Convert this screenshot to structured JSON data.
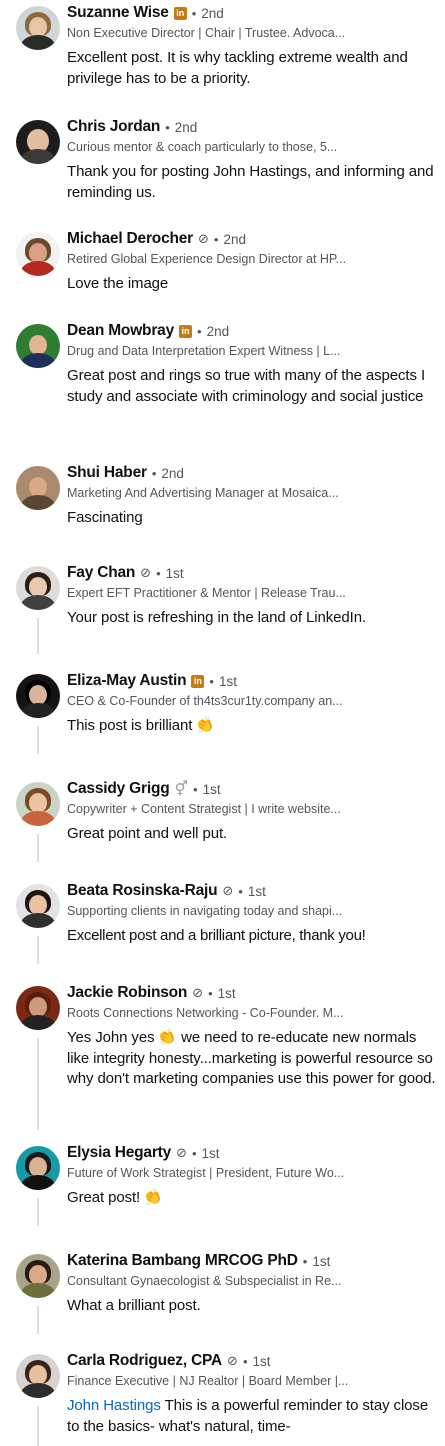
{
  "comments": [
    {
      "name": "Suzanne Wise",
      "badge": "in",
      "verified": false,
      "pronoun": false,
      "sep": "•",
      "degree": "2nd",
      "headline": "Non Executive Director | Chair | Trustee. Advoca...",
      "body": "Excellent post. It is why tackling extreme wealth and privilege has to be a priority."
    },
    {
      "name": "Chris Jordan",
      "badge": "",
      "verified": false,
      "pronoun": false,
      "sep": "•",
      "degree": "2nd",
      "headline": "Curious mentor & coach particularly to those, 5...",
      "body": "Thank you for posting John Hastings, and informing and reminding us."
    },
    {
      "name": "Michael Derocher",
      "badge": "",
      "verified": true,
      "pronoun": false,
      "sep": "•",
      "degree": "2nd",
      "headline": "Retired Global Experience Design Director at HP...",
      "body": "Love the image"
    },
    {
      "name": "Dean Mowbray",
      "badge": "in",
      "verified": false,
      "pronoun": false,
      "sep": "•",
      "degree": "2nd",
      "headline": "Drug and Data Interpretation Expert Witness | L...",
      "body": "Great post and rings so true with many of the aspects I study and associate with criminology and social justice"
    },
    {
      "name": "Shui Haber",
      "badge": "",
      "verified": false,
      "pronoun": false,
      "sep": "•",
      "degree": "2nd",
      "headline": "Marketing And Advertising Manager at Mosaica...",
      "body": "Fascinating"
    },
    {
      "name": "Fay Chan",
      "badge": "",
      "verified": true,
      "pronoun": false,
      "sep": "•",
      "degree": "1st",
      "headline": "Expert EFT Practitioner & Mentor | Release Trau...",
      "body": "Your post is refreshing in the land of LinkedIn."
    },
    {
      "name": "Eliza-May Austin",
      "badge": "in",
      "verified": false,
      "pronoun": false,
      "sep": "•",
      "degree": "1st",
      "headline": "CEO & Co-Founder of th4ts3cur1ty.company an...",
      "body": "This post is brilliant",
      "emoji": "clap"
    },
    {
      "name": "Cassidy Grigg",
      "badge": "",
      "verified": false,
      "pronoun": true,
      "sep": "•",
      "degree": "1st",
      "headline": "Copywriter + Content Strategist | I write website...",
      "body": "Great point and well put."
    },
    {
      "name": "Beata Rosinska-Raju",
      "badge": "",
      "verified": true,
      "pronoun": false,
      "sep": "•",
      "degree": "1st",
      "headline": "Supporting clients in navigating today and shapi...",
      "body": "Excellent post and a brilliant picture, thank you!"
    },
    {
      "name": "Jackie Robinson",
      "badge": "",
      "verified": true,
      "pronoun": false,
      "sep": "•",
      "degree": "1st",
      "headline": "Roots Connections Networking - Co-Founder. M...",
      "body_before": "Yes John yes",
      "body": "we need to re-educate new normals like integrity honesty...marketing is powerful resource so why don't marketing companies use this power for good.",
      "emoji_inline": "clap"
    },
    {
      "name": "Elysia Hegarty",
      "badge": "",
      "verified": true,
      "pronoun": false,
      "sep": "•",
      "degree": "1st",
      "headline": "Future of Work Strategist | President, Future Wo...",
      "body": "Great post!",
      "emoji": "clap"
    },
    {
      "name": "Katerina Bambang MRCOG PhD",
      "badge": "",
      "verified": false,
      "pronoun": false,
      "sep": "•",
      "degree": "1st",
      "headline": "Consultant Gynaecologist & Subspecialist in Re...",
      "body": "What a brilliant post."
    },
    {
      "name": "Carla Rodriguez, CPA",
      "badge": "",
      "verified": true,
      "pronoun": false,
      "sep": "•",
      "degree": "1st",
      "headline": "Finance Executive | NJ Realtor | Board Member |...",
      "mention": "John Hastings",
      "body": "This is a powerful reminder to stay close to the basics- what's natural, time-"
    }
  ],
  "icons": {
    "badge": "linkedin-premium-badge",
    "verified": "verified-icon",
    "pronoun": "pronoun-icon",
    "clap": "clap-emoji"
  },
  "colors": {
    "badge": "#c37d16",
    "mention": "#0a66c2",
    "thread": "#dedede"
  }
}
